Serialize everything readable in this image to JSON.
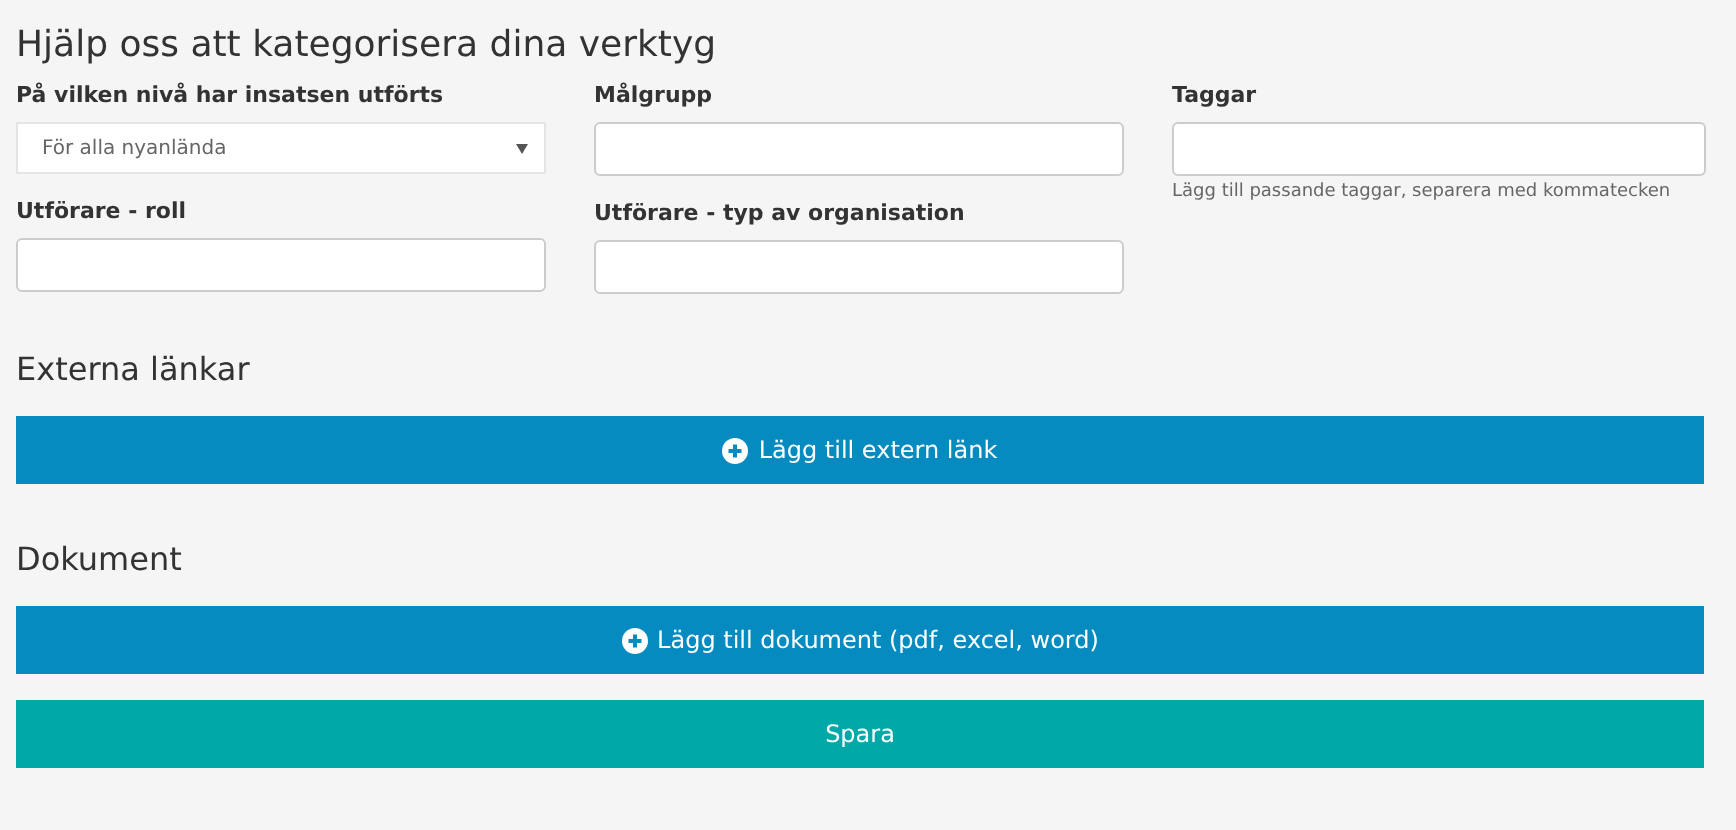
{
  "title": "Hjälp oss att kategorisera dina verktyg",
  "columns": [
    {
      "fields": [
        {
          "kind": "select",
          "label": "På vilken nivå har insatsen utförts",
          "value": "För alla nyanlända"
        },
        {
          "kind": "text",
          "label": "Utförare - roll"
        }
      ]
    },
    {
      "fields": [
        {
          "kind": "text",
          "label": "Målgrupp"
        },
        {
          "kind": "text",
          "label": "Utförare - typ av organisation"
        }
      ]
    },
    {
      "fields": [
        {
          "kind": "text",
          "label": "Taggar",
          "help": "Lägg till passande taggar, separera med kommatecken"
        }
      ]
    }
  ],
  "sections": [
    {
      "heading": "Externa länkar",
      "buttons": [
        {
          "kind": "add",
          "label": "Lägg till extern länk"
        }
      ]
    },
    {
      "heading": "Dokument",
      "buttons": [
        {
          "kind": "add",
          "label": "Lägg till dokument (pdf, excel, word)"
        },
        {
          "kind": "save",
          "label": "Spara"
        }
      ]
    }
  ]
}
